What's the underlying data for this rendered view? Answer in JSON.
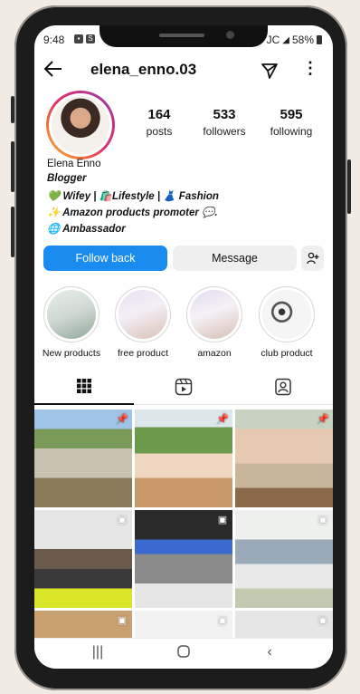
{
  "status_bar": {
    "time": "9:48",
    "indicators": "JC",
    "battery": "58%"
  },
  "top_bar": {
    "username": "elena_enno.03"
  },
  "profile": {
    "stats": [
      {
        "value": "164",
        "label": "posts"
      },
      {
        "value": "533",
        "label": "followers"
      },
      {
        "value": "595",
        "label": "following"
      }
    ],
    "name": "Elena Enno",
    "category": "Blogger",
    "bio_lines": [
      "💚 Wifey | 🛍️Lifestyle | 👗 Fashion",
      "✨ Amazon products promoter 💬.",
      "🌐 Ambassador"
    ]
  },
  "actions": {
    "follow_label": "Follow back",
    "message_label": "Message",
    "add_user_icon": "add-person-icon"
  },
  "highlights": [
    {
      "label": "New products"
    },
    {
      "label": "free product"
    },
    {
      "label": "amazon"
    },
    {
      "label": "club product"
    }
  ],
  "tabs": [
    {
      "icon": "grid-icon",
      "active": true
    },
    {
      "icon": "reels-icon",
      "active": false
    },
    {
      "icon": "tagged-icon",
      "active": false
    }
  ],
  "posts": [
    {
      "badge": "pin-icon"
    },
    {
      "badge": "pin-icon"
    },
    {
      "badge": "pin-icon"
    },
    {
      "badge": "reel-icon"
    },
    {
      "badge": "reel-icon"
    },
    {
      "badge": "reel-icon"
    },
    {
      "badge": "reel-icon"
    },
    {
      "badge": "reel-icon"
    },
    {
      "badge": "reel-icon"
    }
  ],
  "nav": [
    {
      "icon": "recents-icon"
    },
    {
      "icon": "home-icon"
    },
    {
      "icon": "back-icon"
    }
  ],
  "colors": {
    "accent": "#1a8cf0",
    "background": "#f1ebe3"
  }
}
